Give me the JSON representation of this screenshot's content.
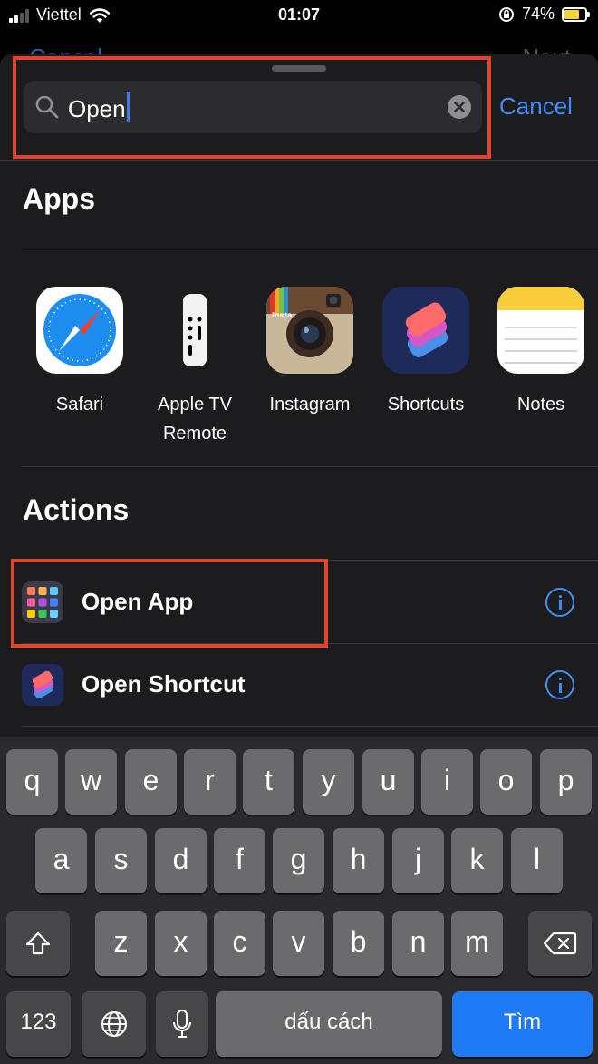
{
  "status_bar": {
    "carrier": "Viettel",
    "time": "01:07",
    "battery": "74%",
    "battery_level": 0.74
  },
  "behind": {
    "left_label": "Cancel",
    "right_label": "Next"
  },
  "search": {
    "value": "Open",
    "cancel_label": "Cancel"
  },
  "apps": {
    "title": "Apps",
    "items": [
      {
        "name": "Safari",
        "icon": "safari-icon"
      },
      {
        "name": "Apple TV\nRemote",
        "icon": "apple-tv-remote-icon"
      },
      {
        "name": "Instagram",
        "icon": "instagram-icon",
        "badge": "Insta"
      },
      {
        "name": "Shortcuts",
        "icon": "shortcuts-icon"
      },
      {
        "name": "Notes",
        "icon": "notes-icon"
      }
    ]
  },
  "actions": {
    "title": "Actions",
    "items": [
      {
        "label": "Open App",
        "icon": "app-grid-icon"
      },
      {
        "label": "Open Shortcut",
        "icon": "shortcuts-icon"
      }
    ]
  },
  "keyboard": {
    "row1": [
      "q",
      "w",
      "e",
      "r",
      "t",
      "y",
      "u",
      "i",
      "o",
      "p"
    ],
    "row2": [
      "a",
      "s",
      "d",
      "f",
      "g",
      "h",
      "j",
      "k",
      "l"
    ],
    "row3": [
      "z",
      "x",
      "c",
      "v",
      "b",
      "n",
      "m"
    ],
    "numbers_label": "123",
    "space_label": "dấu cách",
    "return_label": "Tìm"
  },
  "colors": {
    "accent": "#3d8df5",
    "highlight": "#e0452b",
    "sheet": "#1c1c1e"
  }
}
